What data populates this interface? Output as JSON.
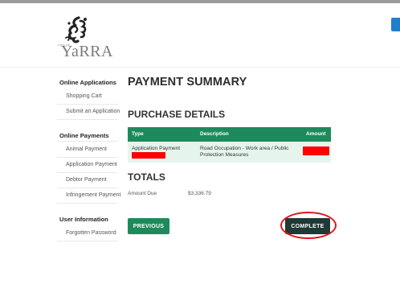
{
  "brand": {
    "logo_small_text": "CITY OF",
    "logo_word": "YaRRA"
  },
  "sidebar": {
    "sections": [
      {
        "heading": "Online Applications",
        "items": [
          "Shopping Cart",
          "Submit an Application"
        ]
      },
      {
        "heading": "Online Payments",
        "items": [
          "Animal Payment",
          "Application Payment",
          "Debtor Payment",
          "Infringement Payment"
        ]
      },
      {
        "heading": "User Information",
        "items": [
          "Forgotten Password"
        ]
      }
    ]
  },
  "main": {
    "title": "PAYMENT SUMMARY",
    "purchase_title": "PURCHASE DETAILS",
    "table": {
      "headers": {
        "type": "Type",
        "description": "Description",
        "amount": "Amount"
      },
      "rows": [
        {
          "type": "Application Payment",
          "description": "Road Occupation - Work area / Public Protection Measures"
        }
      ]
    },
    "totals_title": "TOTALS",
    "amount_due_label": "Amount Due",
    "amount_due_value": "$3,336.79",
    "previous_label": "PREVIOUS",
    "complete_label": "COMPLETE"
  },
  "colors": {
    "primary_green": "#1e8a5b",
    "complete_dark": "#1f3a34",
    "row_tint": "#e5f5ee",
    "redaction": "#ff0000",
    "highlight": "#e0141d"
  }
}
